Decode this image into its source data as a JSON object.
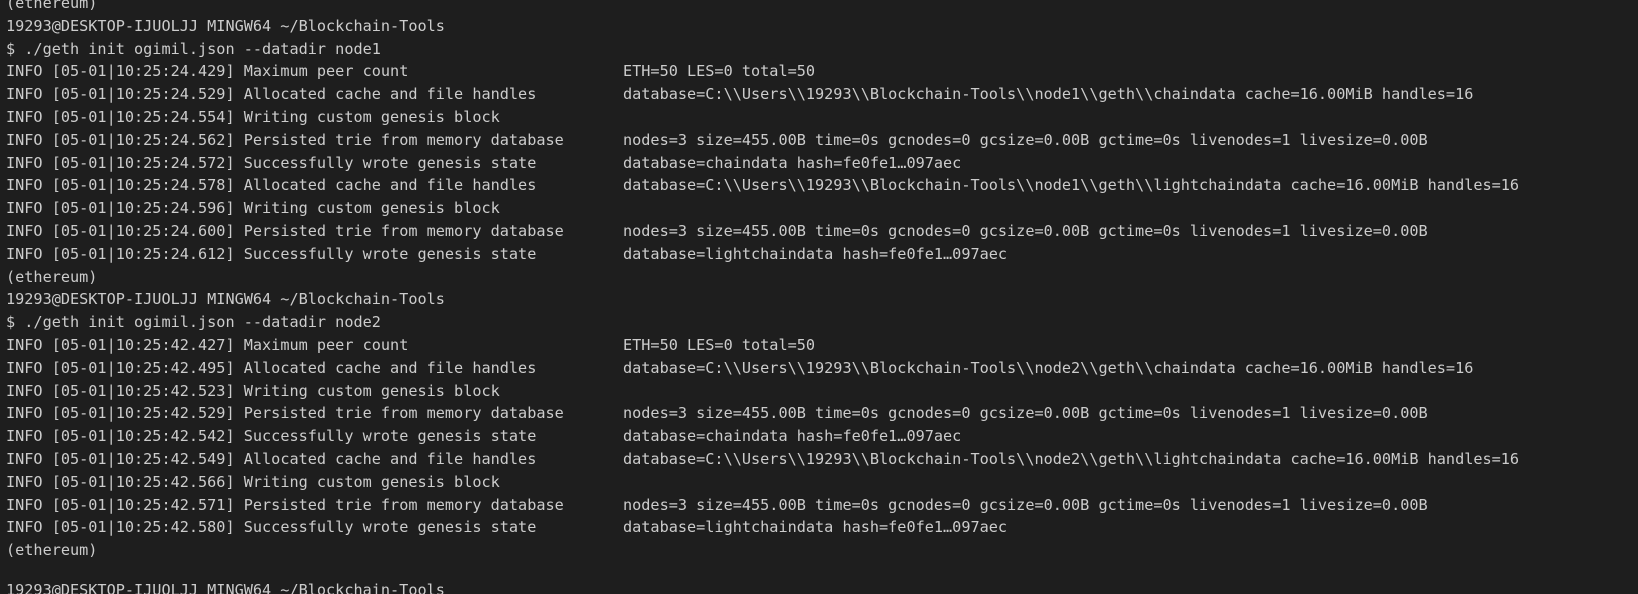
{
  "terminal": {
    "lines": [
      {
        "type": "text",
        "text": "(ethereum)"
      },
      {
        "type": "text",
        "text": "19293@DESKTOP-IJUOLJJ MINGW64 ~/Blockchain-Tools"
      },
      {
        "type": "command",
        "text": "$ ./geth init ogimil.json --datadir node1"
      },
      {
        "type": "log",
        "prefix": "INFO [05-01|10:25:24.429] ",
        "message": "Maximum peer count",
        "fields": "ETH=50 LES=0 total=50"
      },
      {
        "type": "log",
        "prefix": "INFO [05-01|10:25:24.529] ",
        "message": "Allocated cache and file handles",
        "fields": "database=C:\\\\Users\\\\19293\\\\Blockchain-Tools\\\\node1\\\\geth\\\\chaindata cache=16.00MiB handles=16"
      },
      {
        "type": "log",
        "prefix": "INFO [05-01|10:25:24.554] ",
        "message": "Writing custom genesis block",
        "fields": ""
      },
      {
        "type": "log",
        "prefix": "INFO [05-01|10:25:24.562] ",
        "message": "Persisted trie from memory database",
        "fields": "nodes=3 size=455.00B time=0s gcnodes=0 gcsize=0.00B gctime=0s livenodes=1 livesize=0.00B"
      },
      {
        "type": "log",
        "prefix": "INFO [05-01|10:25:24.572] ",
        "message": "Successfully wrote genesis state",
        "fields": "database=chaindata hash=fe0fe1…097aec"
      },
      {
        "type": "log",
        "prefix": "INFO [05-01|10:25:24.578] ",
        "message": "Allocated cache and file handles",
        "fields": "database=C:\\\\Users\\\\19293\\\\Blockchain-Tools\\\\node1\\\\geth\\\\lightchaindata cache=16.00MiB handles=16"
      },
      {
        "type": "log",
        "prefix": "INFO [05-01|10:25:24.596] ",
        "message": "Writing custom genesis block",
        "fields": ""
      },
      {
        "type": "log",
        "prefix": "INFO [05-01|10:25:24.600] ",
        "message": "Persisted trie from memory database",
        "fields": "nodes=3 size=455.00B time=0s gcnodes=0 gcsize=0.00B gctime=0s livenodes=1 livesize=0.00B"
      },
      {
        "type": "log",
        "prefix": "INFO [05-01|10:25:24.612] ",
        "message": "Successfully wrote genesis state",
        "fields": "database=lightchaindata hash=fe0fe1…097aec"
      },
      {
        "type": "text",
        "text": "(ethereum)"
      },
      {
        "type": "text",
        "text": "19293@DESKTOP-IJUOLJJ MINGW64 ~/Blockchain-Tools"
      },
      {
        "type": "command",
        "text": "$ ./geth init ogimil.json --datadir node2"
      },
      {
        "type": "log",
        "prefix": "INFO [05-01|10:25:42.427] ",
        "message": "Maximum peer count",
        "fields": "ETH=50 LES=0 total=50"
      },
      {
        "type": "log",
        "prefix": "INFO [05-01|10:25:42.495] ",
        "message": "Allocated cache and file handles",
        "fields": "database=C:\\\\Users\\\\19293\\\\Blockchain-Tools\\\\node2\\\\geth\\\\chaindata cache=16.00MiB handles=16"
      },
      {
        "type": "log",
        "prefix": "INFO [05-01|10:25:42.523] ",
        "message": "Writing custom genesis block",
        "fields": ""
      },
      {
        "type": "log",
        "prefix": "INFO [05-01|10:25:42.529] ",
        "message": "Persisted trie from memory database",
        "fields": "nodes=3 size=455.00B time=0s gcnodes=0 gcsize=0.00B gctime=0s livenodes=1 livesize=0.00B"
      },
      {
        "type": "log",
        "prefix": "INFO [05-01|10:25:42.542] ",
        "message": "Successfully wrote genesis state",
        "fields": "database=chaindata hash=fe0fe1…097aec"
      },
      {
        "type": "log",
        "prefix": "INFO [05-01|10:25:42.549] ",
        "message": "Allocated cache and file handles",
        "fields": "database=C:\\\\Users\\\\19293\\\\Blockchain-Tools\\\\node2\\\\geth\\\\lightchaindata cache=16.00MiB handles=16"
      },
      {
        "type": "log",
        "prefix": "INFO [05-01|10:25:42.566] ",
        "message": "Writing custom genesis block",
        "fields": ""
      },
      {
        "type": "log",
        "prefix": "INFO [05-01|10:25:42.571] ",
        "message": "Persisted trie from memory database",
        "fields": "nodes=3 size=455.00B time=0s gcnodes=0 gcsize=0.00B gctime=0s livenodes=1 livesize=0.00B"
      },
      {
        "type": "log",
        "prefix": "INFO [05-01|10:25:42.580] ",
        "message": "Successfully wrote genesis state",
        "fields": "database=lightchaindata hash=fe0fe1…097aec"
      },
      {
        "type": "text",
        "text": "(ethereum)"
      }
    ],
    "partial_line": "19293@DESKTOP-IJUOLJJ MINGW64 ~/Blockchain-Tools"
  }
}
